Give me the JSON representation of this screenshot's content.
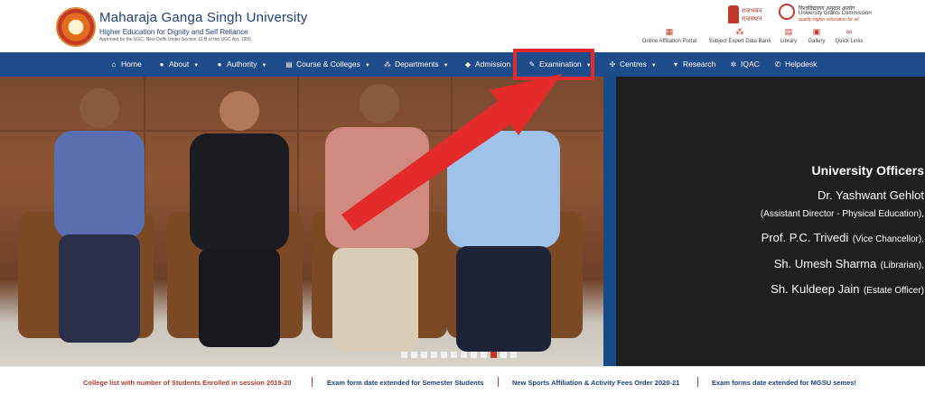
{
  "header": {
    "university_name": "Maharaja Ganga Singh University",
    "tagline": "Higher Education for Dignity and Self Reliance",
    "approval": "Approved by the UGC, New Delhi Under Section 12 B of the UGC Act, 1956",
    "rajbhawan_line1": "राजभवन",
    "rajbhawan_line2": "राजस्थान",
    "ugc_hindi": "विश्वविद्यालय अनुदान आयोग",
    "ugc_english": "University Grants Commission",
    "ugc_motto": "quality higher education for all"
  },
  "quick_links": [
    {
      "label": "Online Affiliation Portal",
      "icon": "grid-icon"
    },
    {
      "label": "Subject Expert Data Bank",
      "icon": "network-icon"
    },
    {
      "label": "Library",
      "icon": "book-icon"
    },
    {
      "label": "Gallery",
      "icon": "image-icon"
    },
    {
      "label": "Quick Links",
      "icon": "link-icon"
    }
  ],
  "nav": {
    "home": "Home",
    "about": "About",
    "authority": "Authority",
    "courses": "Course & Colleges",
    "departments": "Departments",
    "admission": "Admission",
    "examination": "Examination",
    "centres": "Centres",
    "research": "Research",
    "iqac": "IQAC",
    "helpdesk": "Helpdesk"
  },
  "officers": {
    "title": "University Officers",
    "o1_name": "Dr. Yashwant Gehlot",
    "o1_desig": "(Assistant Director - Physical Education),",
    "o2_name": "Prof. P.C. Trivedi",
    "o2_desig": "(Vice Chancellor),",
    "o3_name": "Sh. Umesh Sharma",
    "o3_desig": "(Librarian),",
    "o4_name": "Sh. Kuldeep Jain",
    "o4_desig": "(Estate Officer)"
  },
  "slider": {
    "slide_count": 12,
    "active_index": 9
  },
  "ticker": {
    "t1": "College list with number of Students Enrolled in session 2019-20",
    "t2": "Exam form date extended for Semester Students",
    "t3": "New Sports Affiliation & Activity Fees Order 2020-21",
    "t4": "Exam forms date extended for MGSU semes!"
  },
  "colors": {
    "nav_bg": "#1e4c8a",
    "accent_red": "#c0392b",
    "annotation": "#e32b2b"
  }
}
